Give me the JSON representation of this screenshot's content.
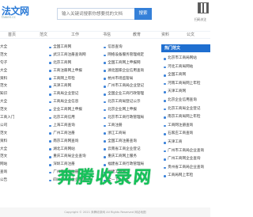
{
  "header": {
    "logo_text": "法文网",
    "logo_sub": "fawen.cc",
    "search_placeholder": "输入关键词搜索你想要找的文档",
    "search_button": "搜索",
    "qr_caption": "扫码关注"
  },
  "nav": [
    "首页",
    "范文",
    "工作",
    "书信",
    "教育",
    "资料",
    "公文"
  ],
  "columns": [
    [
      "大全",
      "范文",
      "句子",
      "大全",
      "资料",
      "范文",
      "知识",
      "大全",
      "范文",
      "工商入门",
      "公司",
      "范文",
      "资料",
      "大全",
      "范文",
      "网站",
      "查询",
      "公告"
    ],
    [
      "全国工商网",
      "武汉工商注册查询网",
      "北京工商网",
      "工商注册网上申报",
      "工商网上年检",
      "天津工商网",
      "工商局企业登记",
      "工商局企业信息",
      "企业工商网上申报",
      "北京工商信用",
      "上海工商查询",
      "广州工商注册",
      "南京工商网查询",
      "湖北工商网站",
      "重庆工商局企业查询",
      "深圳工商注册",
      "广州市工商注册",
      "四川工商局企业查询"
    ],
    [
      "信息查询",
      "网络设备服务管理规定",
      "全国工商网上申报网",
      "湖北国家企业信用查询",
      "杭州市场监管局",
      "广州市工商局企业登记",
      "全国企业工商行政管理",
      "北京工商局登记公示",
      "北京企业网上申报",
      "北京市工商行政管理局",
      "工商注册",
      "浙江工商局",
      "全国工商注册查询",
      "云南省工商企业登记",
      "重庆工商网上服务",
      "福建省工商行政管理局",
      "福建工商网",
      "全一下ry大全"
    ]
  ],
  "hot": {
    "title": "热门范文",
    "items": [
      "北京市工商局网站",
      "河北工商局网站",
      "全国工商网",
      "河南工商局网上年检",
      "天津工商网",
      "北京企业信用查询",
      "北京工商局企业登记",
      "南京工商局网上年检",
      "工商网注册查询",
      "石家庄工商查询",
      "天津工商",
      "广州市工商局企业查询",
      "广州工商网企业查询",
      "贵州省工商局企业查询",
      "工商局网上年检"
    ]
  },
  "watermark": "奔腾收录网",
  "footer": "Copyright © 2021 奔腾收录网 All Rights Reserved 网站地图"
}
